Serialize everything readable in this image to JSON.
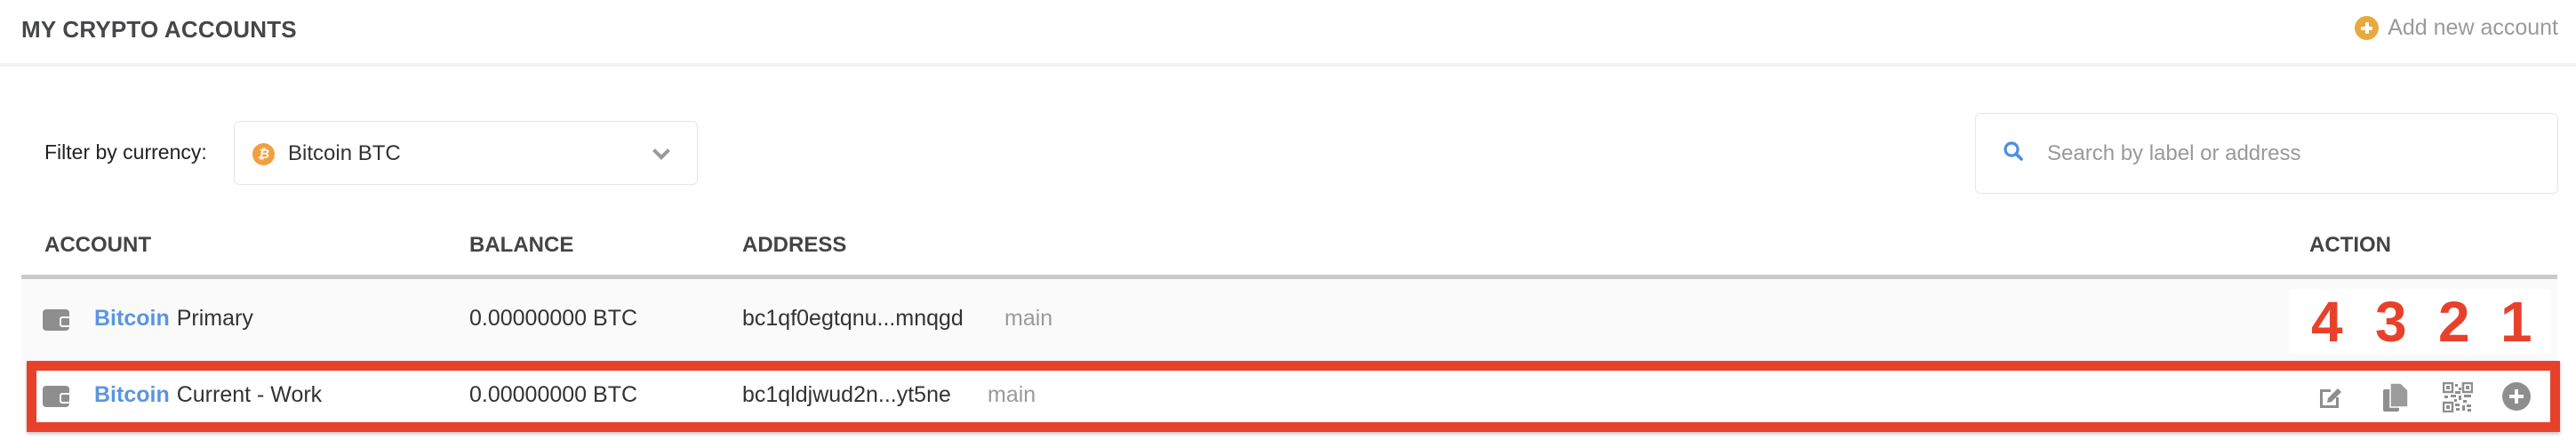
{
  "header": {
    "title": "MY CRYPTO ACCOUNTS",
    "add_account_label": "Add new account",
    "add_icon": "plus-circle-icon",
    "accent_color": "#e9a93e"
  },
  "filter": {
    "label": "Filter by currency:",
    "selected": "Bitcoin BTC",
    "currency_icon": "bitcoin-icon",
    "currency_symbol": "₿"
  },
  "search": {
    "placeholder": "Search by label or address",
    "value": ""
  },
  "table": {
    "columns": [
      "ACCOUNT",
      "BALANCE",
      "ADDRESS",
      "ACTION"
    ],
    "rows": [
      {
        "coin": "Bitcoin",
        "label": "Primary",
        "balance": "0.00000000 BTC",
        "address": "bc1qf0egtqnu...mnqgd",
        "network": "main"
      },
      {
        "coin": "Bitcoin",
        "label": "Current - Work",
        "balance": "0.00000000 BTC",
        "address": "bc1qldjwud2n...yt5ne",
        "network": "main",
        "highlighted": true
      }
    ],
    "actions": [
      {
        "name": "edit",
        "icon": "edit-icon",
        "annotation": "4"
      },
      {
        "name": "copy",
        "icon": "copy-icon",
        "annotation": "3"
      },
      {
        "name": "qr-code",
        "icon": "qr-code-icon",
        "annotation": "2"
      },
      {
        "name": "add",
        "icon": "plus-circle-icon",
        "annotation": "1"
      }
    ]
  },
  "annotation_color": "#e8412b"
}
